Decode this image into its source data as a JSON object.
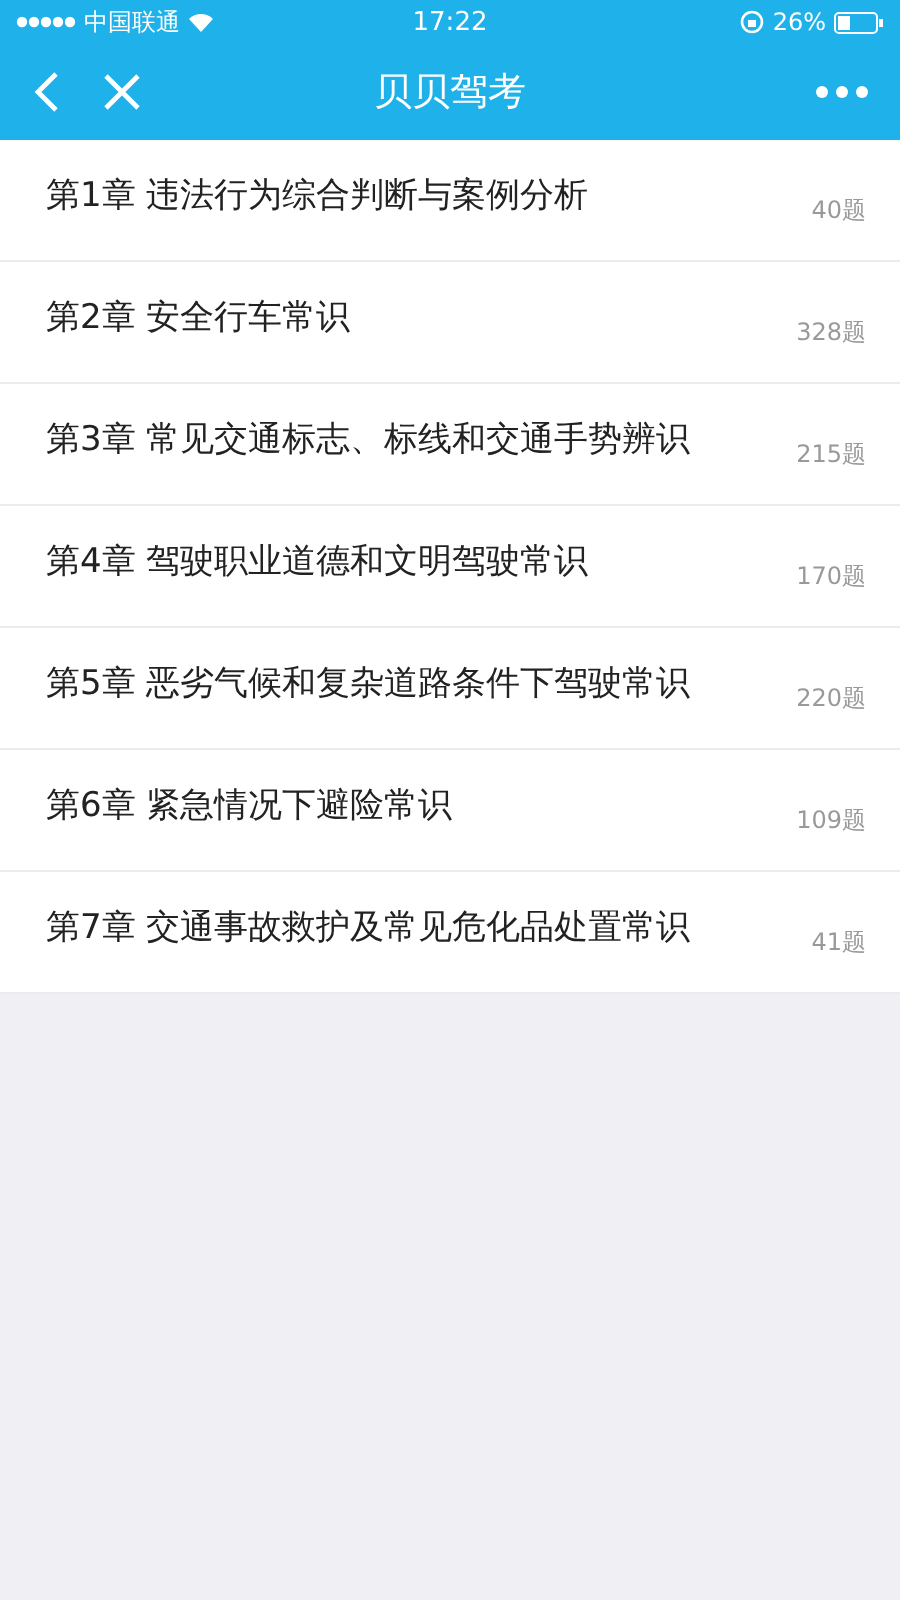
{
  "status_bar": {
    "carrier": "中国联通",
    "time": "17:22",
    "battery": "26%"
  },
  "nav_bar": {
    "title": "贝贝驾考"
  },
  "chapters": [
    {
      "title": "第1章 违法行为综合判断与案例分析",
      "count": "40题"
    },
    {
      "title": "第2章 安全行车常识",
      "count": "328题"
    },
    {
      "title": "第3章 常见交通标志、标线和交通手势辨识",
      "count": "215题"
    },
    {
      "title": "第4章 驾驶职业道德和文明驾驶常识",
      "count": "170题"
    },
    {
      "title": "第5章 恶劣气候和复杂道路条件下驾驶常识",
      "count": "220题"
    },
    {
      "title": "第6章 紧急情况下避险常识",
      "count": "109题"
    },
    {
      "title": "第7章 交通事故救护及常见危化品处置常识",
      "count": "41题"
    }
  ]
}
